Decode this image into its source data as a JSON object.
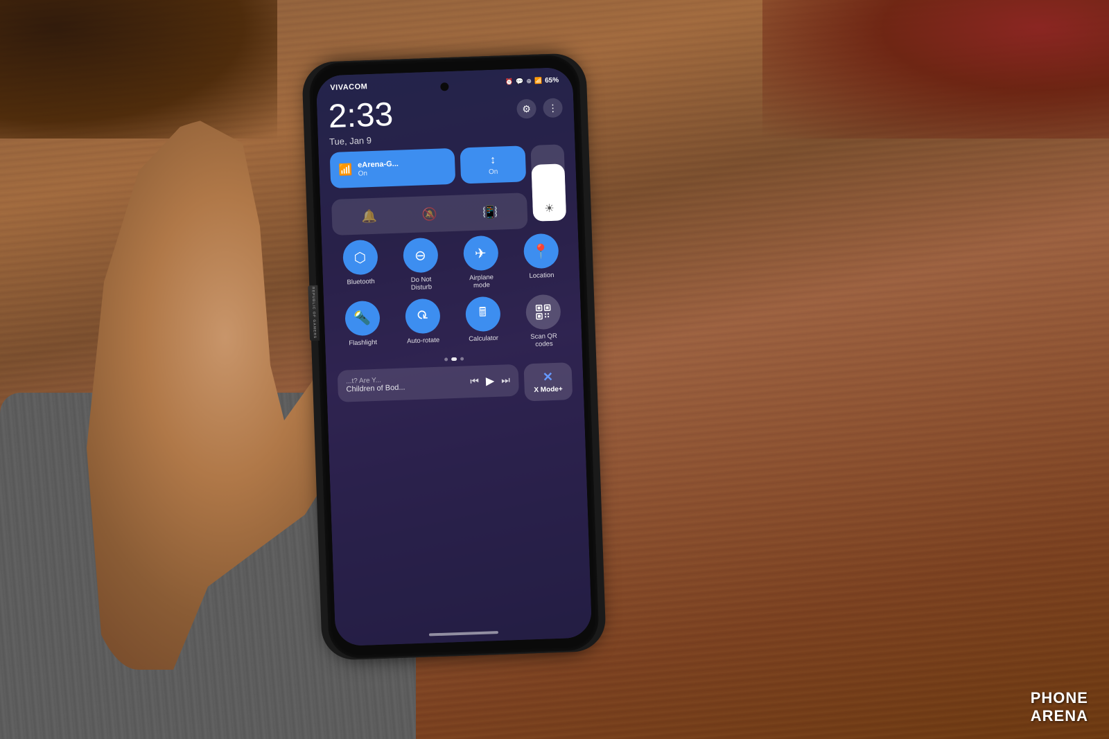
{
  "background": {
    "description": "Wooden table with hand holding phone"
  },
  "phone": {
    "carrier": "VIVACOM",
    "time": "2:33",
    "date": "Tue, Jan 9",
    "battery": "65%",
    "status_icons": "⏰ 💬 ⚙ ✦ 📶"
  },
  "quick_settings": {
    "wifi_tile": {
      "label": "eArena-G...",
      "sublabel": "On",
      "active": true
    },
    "data_tile": {
      "label": "↕",
      "sublabel": "On",
      "active": true
    },
    "sound_icons": [
      {
        "name": "bell",
        "icon": "🔔",
        "active": false
      },
      {
        "name": "mute",
        "icon": "🔕",
        "active": false
      },
      {
        "name": "vibrate",
        "icon": "📳",
        "active": true
      }
    ],
    "quick_toggles": [
      {
        "id": "bluetooth",
        "label": "Bluetooth",
        "icon": "⬡",
        "active": true
      },
      {
        "id": "dnd",
        "label": "Do Not\nDisturb",
        "icon": "⊖",
        "active": true
      },
      {
        "id": "airplane",
        "label": "Airplane\nmode",
        "icon": "✈",
        "active": true
      },
      {
        "id": "location",
        "label": "Location",
        "icon": "📍",
        "active": true
      },
      {
        "id": "flashlight",
        "label": "Flashlight",
        "icon": "🔦",
        "active": true
      },
      {
        "id": "autorotate",
        "label": "Auto-rotate",
        "icon": "⟳",
        "active": true
      },
      {
        "id": "calculator",
        "label": "Calculator",
        "icon": "🖩",
        "active": true
      },
      {
        "id": "qr",
        "label": "Scan QR\ncodes",
        "icon": "⊞",
        "active": false
      }
    ],
    "media": {
      "title": "...t? Are Y...",
      "artist": "Children of Bod...",
      "controls": [
        "⏮",
        "⏵",
        "⏭"
      ]
    },
    "x_mode": {
      "label": "X Mode+"
    },
    "settings_icon": "⚙",
    "more_icon": "⋮"
  },
  "watermark": {
    "line1": "PHONE",
    "line2": "ARENA"
  }
}
